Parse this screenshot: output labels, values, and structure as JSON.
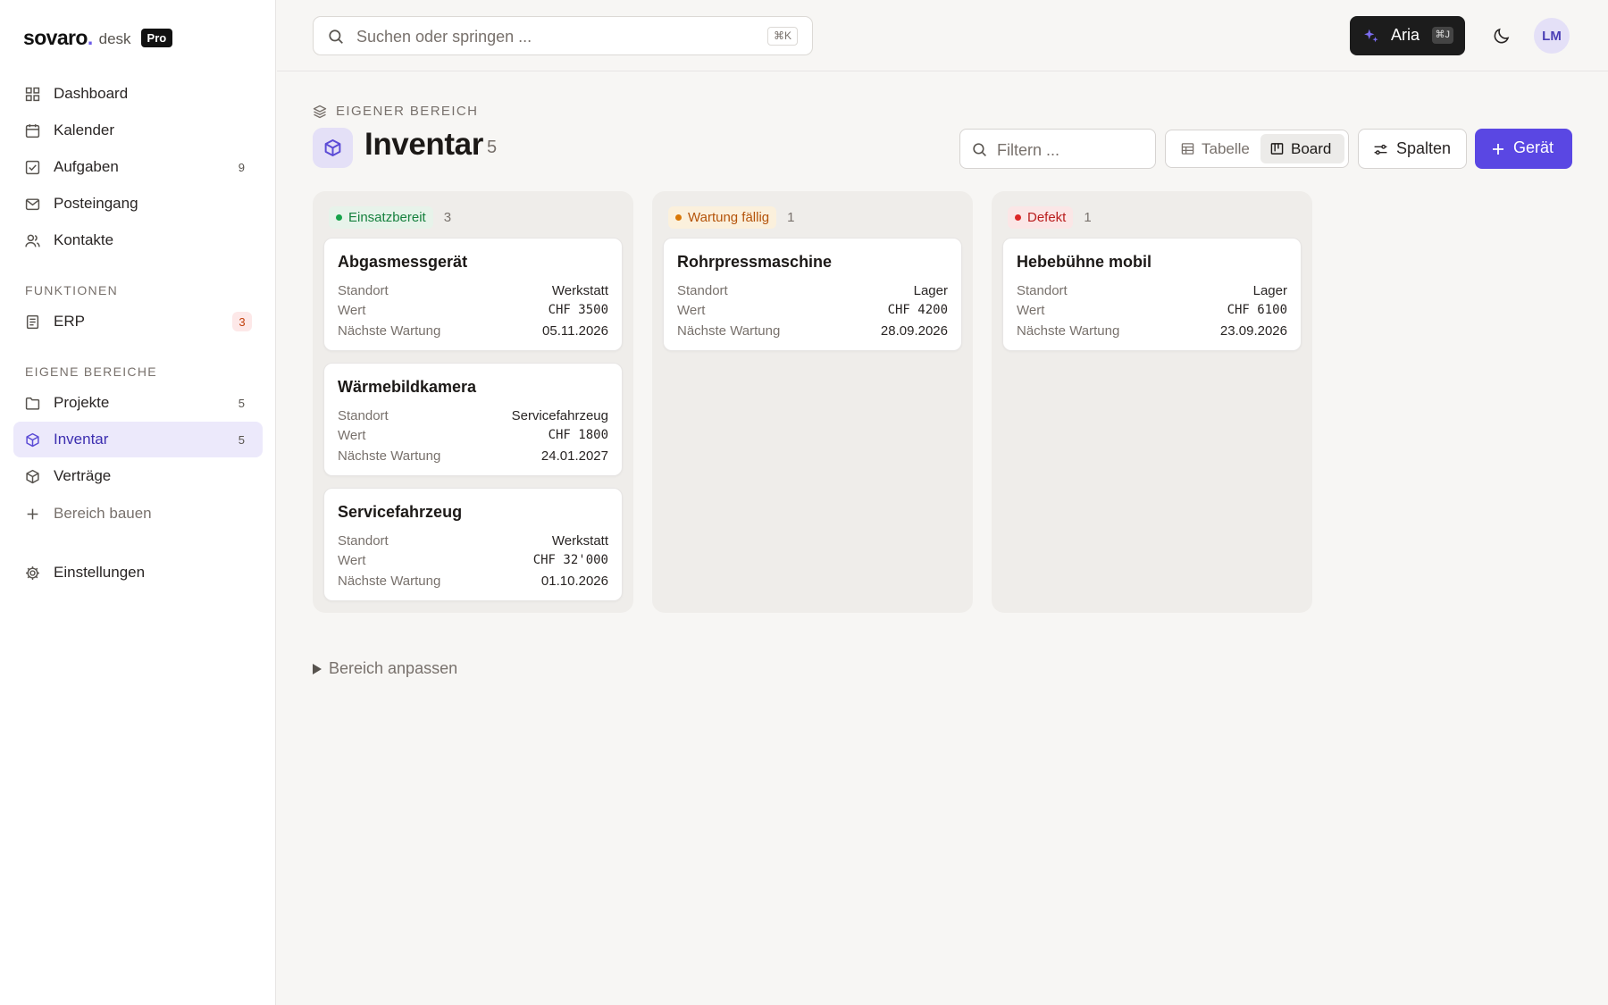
{
  "brand": {
    "name": "sovaro",
    "dot": ".",
    "product": "desk",
    "tier": "Pro"
  },
  "colors": {
    "accent": "#5a47e3",
    "ready": "#16a34a",
    "due": "#d97706",
    "defect": "#dc2626"
  },
  "sidebar": {
    "main": [
      {
        "label": "Dashboard",
        "icon": "grid-icon"
      },
      {
        "label": "Kalender",
        "icon": "calendar-icon"
      },
      {
        "label": "Aufgaben",
        "icon": "checkbox-icon",
        "count": "9"
      },
      {
        "label": "Posteingang",
        "icon": "mail-icon"
      },
      {
        "label": "Kontakte",
        "icon": "users-icon"
      }
    ],
    "functions_title": "FUNKTIONEN",
    "functions": [
      {
        "label": "ERP",
        "icon": "document-icon",
        "badge": "3"
      }
    ],
    "areas_title": "EIGENE BEREICHE",
    "areas": [
      {
        "label": "Projekte",
        "icon": "folder-icon",
        "count": "5"
      },
      {
        "label": "Inventar",
        "icon": "box-icon",
        "count": "5",
        "active": true
      },
      {
        "label": "Verträge",
        "icon": "box-icon"
      }
    ],
    "build_label": "Bereich bauen",
    "settings_label": "Einstellungen"
  },
  "topbar": {
    "search_placeholder": "Suchen oder springen ...",
    "search_shortcut": "⌘K",
    "assistant_label": "Aria",
    "assistant_shortcut": "⌘J",
    "avatar_initials": "LM"
  },
  "header": {
    "breadcrumb": "EIGENER BEREICH",
    "title": "Inventar",
    "count": "5",
    "filter_placeholder": "Filtern ...",
    "view_table": "Tabelle",
    "view_board": "Board",
    "columns_button": "Spalten",
    "add_button": "Gerät"
  },
  "board": {
    "columns": [
      {
        "status": "Einsatzbereit",
        "count": "3",
        "cards": [
          {
            "title": "Abgasmessgerät",
            "rows": [
              {
                "k": "Standort",
                "v": "Werkstatt"
              },
              {
                "k": "Wert",
                "v": "CHF 3500"
              },
              {
                "k": "Nächste Wartung",
                "v": "05.11.2026"
              }
            ]
          },
          {
            "title": "Wärmebildkamera",
            "rows": [
              {
                "k": "Standort",
                "v": "Servicefahrzeug"
              },
              {
                "k": "Wert",
                "v": "CHF 1800"
              },
              {
                "k": "Nächste Wartung",
                "v": "24.01.2027"
              }
            ]
          },
          {
            "title": "Servicefahrzeug",
            "rows": [
              {
                "k": "Standort",
                "v": "Werkstatt"
              },
              {
                "k": "Wert",
                "v": "CHF 32'000"
              },
              {
                "k": "Nächste Wartung",
                "v": "01.10.2026"
              }
            ]
          }
        ]
      },
      {
        "status": "Wartung fällig",
        "count": "1",
        "cards": [
          {
            "title": "Rohrpressmaschine",
            "rows": [
              {
                "k": "Standort",
                "v": "Lager"
              },
              {
                "k": "Wert",
                "v": "CHF 4200"
              },
              {
                "k": "Nächste Wartung",
                "v": "28.09.2026"
              }
            ]
          }
        ]
      },
      {
        "status": "Defekt",
        "count": "1",
        "cards": [
          {
            "title": "Hebebühne mobil",
            "rows": [
              {
                "k": "Standort",
                "v": "Lager"
              },
              {
                "k": "Wert",
                "v": "CHF 6100"
              },
              {
                "k": "Nächste Wartung",
                "v": "23.09.2026"
              }
            ]
          }
        ]
      }
    ]
  },
  "footer": {
    "customize_label": "Bereich anpassen"
  }
}
